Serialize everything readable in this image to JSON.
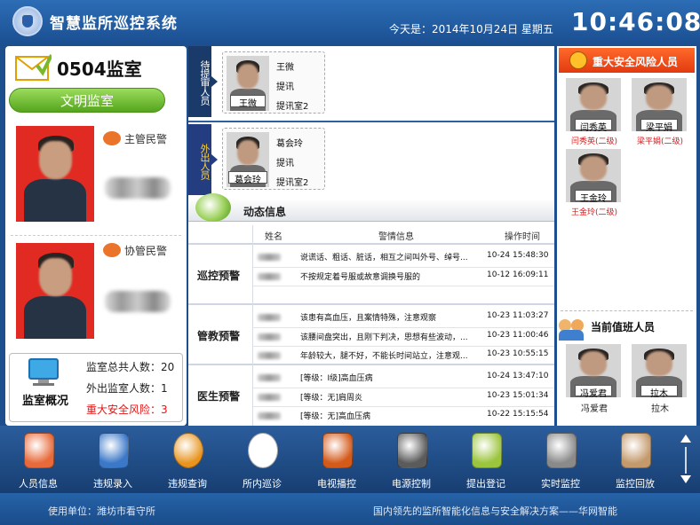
{
  "header": {
    "title": "智慧监所巡控系统",
    "date_line": "今天是：2014年10月24日  星期五",
    "clock": "10:46:08"
  },
  "left": {
    "room": "0504监室",
    "status_button": "文明监室",
    "chief_label": "主管民警",
    "assist_label": "协管民警",
    "overview": {
      "title": "监室概况",
      "total": "监室总共人数：20",
      "outside": "外出监室人数：1",
      "risk": "重大安全风险：3"
    }
  },
  "middle": {
    "pending_tab": "待提审人员",
    "out_tab": "外出人员",
    "pending": {
      "name": "王微",
      "reason": "提讯",
      "room": "提讯室2",
      "plate": "王微"
    },
    "out": {
      "name": "葛会玲",
      "reason": "提讯",
      "room": "提讯室2",
      "plate": "葛会玲"
    },
    "dynamic_title": "动态信息",
    "columns": [
      "姓名",
      "警情信息",
      "操作时间"
    ],
    "groups": [
      {
        "category": "巡控预警",
        "rows": [
          {
            "info": "说谎话、粗话、脏话，相互之间叫外号、绰号...",
            "time": "10-24  15:48:30"
          },
          {
            "info": "不按规定着号服或故意调换号服的",
            "time": "10-12  16:09:11"
          },
          {
            "info": "",
            "time": ""
          }
        ]
      },
      {
        "category": "管教预警",
        "rows": [
          {
            "info": "该患有高血压，且案情特殊，注意观察",
            "time": "10-23  11:03:27"
          },
          {
            "info": "该腰间盘突出，且刚下判决，思想有些波动，...",
            "time": "10-23  11:00:46"
          },
          {
            "info": "年龄较大，腿不好，不能长时间站立，注意观...",
            "time": "10-23  10:55:15"
          }
        ]
      },
      {
        "category": "医生预警",
        "rows": [
          {
            "info": "[等级：Ⅰ级]高血压病",
            "time": "10-24  13:47:10"
          },
          {
            "info": "[等级：无]肩周炎",
            "time": "10-23  15:01:34"
          },
          {
            "info": "[等级：无]高血压病",
            "time": "10-22  15:15:54"
          }
        ]
      }
    ]
  },
  "right": {
    "risk_title": "重大安全风险人员",
    "risk_people": [
      {
        "plate": "闫秀英",
        "label": "闫秀英(二级)"
      },
      {
        "plate": "梁平娟",
        "label": "梁平娟(二级)"
      },
      {
        "plate": "王金玲",
        "label": "王金玲(二级)"
      }
    ],
    "duty_title": "当前值班人员",
    "duty_people": [
      {
        "plate": "冯爱君",
        "label": "冯爱君"
      },
      {
        "plate": "拉木",
        "label": "拉木"
      }
    ]
  },
  "toolbar": {
    "items": [
      {
        "label": "人员信息",
        "icon": "people-icon"
      },
      {
        "label": "违规录入",
        "icon": "notebook-icon"
      },
      {
        "label": "违规查询",
        "icon": "clock-alert-icon"
      },
      {
        "label": "所内巡诊",
        "icon": "doctor-icon"
      },
      {
        "label": "电视播控",
        "icon": "tv-icon"
      },
      {
        "label": "电源控制",
        "icon": "battery-icon"
      },
      {
        "label": "提出登记",
        "icon": "register-icon"
      },
      {
        "label": "实时监控",
        "icon": "camera-icon"
      },
      {
        "label": "监控回放",
        "icon": "playback-icon"
      }
    ]
  },
  "footer": {
    "left": "使用单位：潍坊市看守所",
    "right": "国内领先的监所智能化信息与安全解决方案——华网智能"
  },
  "colors": {
    "header": "#2c6db5",
    "accent_green": "#55a51e",
    "risk_red": "#e23a10",
    "nav_dark": "#173e72"
  }
}
